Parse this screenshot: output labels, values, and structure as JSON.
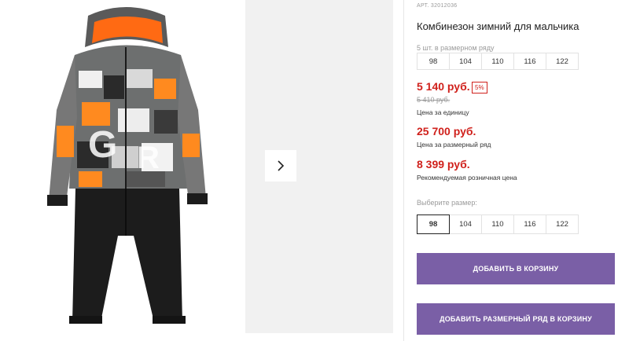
{
  "colors": {
    "accent": "#7a5fa6",
    "price": "#d0211c",
    "muted": "#9a9a9a",
    "gallery_bg": "#f1f1f1"
  },
  "gallery": {
    "image_icon": "snowsuit-image",
    "next_icon": "chevron-right-icon"
  },
  "product": {
    "sku": "АРТ. 32012036",
    "title": "Комбинезон зимний для мальчика",
    "set_note": "5 шт. в размерном ряду",
    "set_sizes": [
      "98",
      "104",
      "110",
      "116",
      "122"
    ],
    "unit_price": "5 140 руб.",
    "discount": "5%",
    "old_price": "5 410 руб.",
    "unit_price_caption": "Цена за единицу",
    "set_price": "25 700 руб.",
    "set_price_caption": "Цена за размерный ряд",
    "retail_price": "8 399 руб.",
    "retail_price_caption": "Рекомендуемая розничная цена",
    "choose_size_label": "Выберите размер:",
    "size_options": [
      "98",
      "104",
      "110",
      "116",
      "122"
    ],
    "selected_size": "98"
  },
  "actions": {
    "add_to_cart": "ДОБАВИТЬ В КОРЗИНУ",
    "add_set_to_cart": "ДОБАВИТЬ РАЗМЕРНЫЙ РЯД В КОРЗИНУ"
  }
}
